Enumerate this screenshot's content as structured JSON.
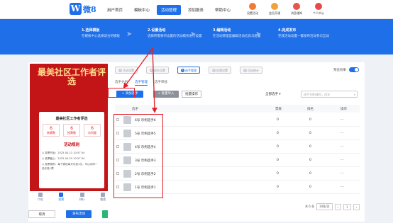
{
  "logo": {
    "letter": "W",
    "text": "微8"
  },
  "nav": [
    "用户首页",
    "模板中心",
    "活动管理",
    "添加服务",
    "帮助中心"
  ],
  "right_nav": [
    {
      "label": "设置活动",
      "color": "#f07a3a"
    },
    {
      "label": "会员开通",
      "color": "#f0a23a"
    },
    {
      "label": "消息通知",
      "color": "#e9544d"
    },
    {
      "label": "个人中心",
      "color": "#e64a4a"
    }
  ],
  "steps": [
    {
      "title": "1.选择模板",
      "desc": "在模板中心选择适合的模板"
    },
    {
      "title": "2.设置活动",
      "desc": "选择所需要的设置的活动模块进行设置"
    },
    {
      "title": "3.编辑活动",
      "desc": "在活动管理里编辑活动信息与配置"
    },
    {
      "title": "4.完成发布",
      "desc": "完成活动设置一键发布活动参与互动"
    }
  ],
  "poster": {
    "title": "最美社区工作者评选",
    "card_name": "最美社区工作者评选",
    "stats": [
      {
        "n": "6",
        "l": "参赛数"
      },
      {
        "n": "6",
        "l": "投票数"
      },
      {
        "n": "6",
        "l": "访问量"
      }
    ],
    "rules_title": "活动规则",
    "rule_lines": [
      "◎ 投票开始：2025-04-22 10:57:34",
      "◎ 投票截止：2025-04-29 10:57:34",
      "◎ 投票规则：每个微信每天可投1次，可以对同一",
      "   选手投1票"
    ]
  },
  "tabbar": [
    "介绍",
    "投票",
    "排行",
    "搜索"
  ],
  "bottom_buttons": [
    "取消",
    "发布活动",
    "活动预览"
  ],
  "stepper": [
    "活动设置",
    "报名设置",
    "选手管理",
    "投票设置",
    "活动统计"
  ],
  "preview_label": "预览效果",
  "subtabs": [
    "选手分组",
    "选手管理",
    "选手审核"
  ],
  "toolbar": {
    "add": "+ 添加选手",
    "batch_grey": "+ 批量导入",
    "batch": "批量操作",
    "select": "全部选手 ▾",
    "search_placeholder": "选手名称/编号，回车"
  },
  "table": {
    "headers": [
      "选手",
      "票数",
      "排名",
      "操作"
    ],
    "rows": [
      {
        "name": "6号  示例选手6",
        "votes": "0",
        "rank": "0",
        "op": "···"
      },
      {
        "name": "5号  示例选手5",
        "votes": "0",
        "rank": "0",
        "op": "···"
      },
      {
        "name": "4号  示例选手4",
        "votes": "0",
        "rank": "0",
        "op": "···"
      },
      {
        "name": "3号  示例选手3",
        "votes": "0",
        "rank": "0",
        "op": "···"
      },
      {
        "name": "2号  示例选手2",
        "votes": "0",
        "rank": "0",
        "op": "···"
      },
      {
        "name": "1号  示例选手1",
        "votes": "0",
        "rank": "0",
        "op": "···"
      }
    ]
  },
  "pager": {
    "total": "共 6 条",
    "size": "10条/页",
    "page": "1",
    "go": "前往"
  }
}
